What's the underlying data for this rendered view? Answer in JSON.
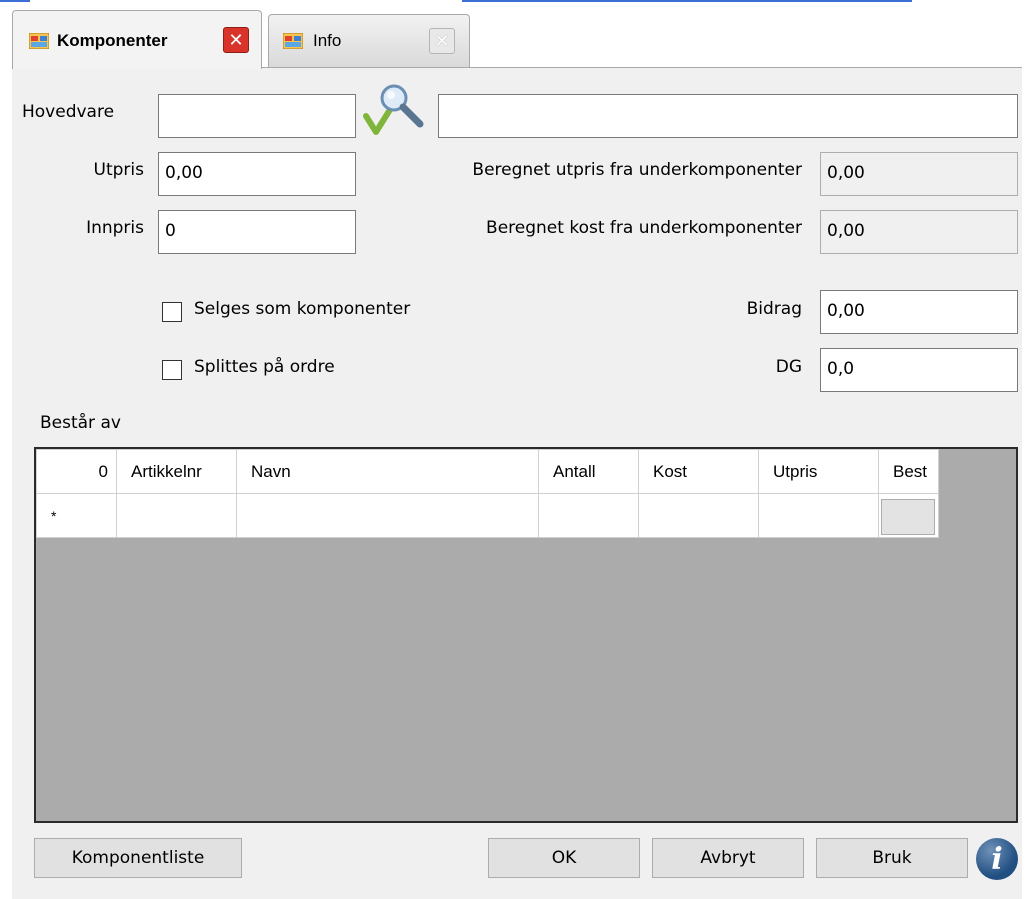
{
  "tabs": [
    {
      "label": "Komponenter",
      "active": true,
      "icon": "window-icon",
      "close_icon": "close-red-icon"
    },
    {
      "label": "Info",
      "active": false,
      "icon": "window-icon",
      "close_icon": "close-gray-icon"
    }
  ],
  "form": {
    "hovedvare": {
      "label": "Hovedvare",
      "code_value": "",
      "description_value": "",
      "search_icon": "search-magnifier-icon"
    },
    "utpris": {
      "label": "Utpris",
      "value": "0,00"
    },
    "innpris": {
      "label": "Innpris",
      "value": "0"
    },
    "beregnet_utpris": {
      "label": "Beregnet utpris fra underkomponenter",
      "value": "0,00"
    },
    "beregnet_kost": {
      "label": "Beregnet kost fra underkomponenter",
      "value": "0,00"
    },
    "bidrag": {
      "label": "Bidrag",
      "value": "0,00"
    },
    "dg": {
      "label": "DG",
      "value": "0,0"
    },
    "selges_som_komponenter": {
      "label": "Selges som komponenter",
      "checked": false
    },
    "splittes_paa_ordre": {
      "label": "Splittes på ordre",
      "checked": false
    }
  },
  "grid": {
    "section_label": "Består av",
    "row_count": "0",
    "columns": [
      "Artikkelnr",
      "Navn",
      "Antall",
      "Kost",
      "Utpris",
      "Best"
    ],
    "new_row_marker": "*"
  },
  "buttons": {
    "komponentliste": "Komponentliste",
    "ok": "OK",
    "avbryt": "Avbryt",
    "bruk": "Bruk",
    "info_icon_glyph": "i"
  },
  "colors": {
    "tab_close_active": "#d9342b",
    "panel_bg": "#f0f0f0",
    "grid_bg": "#ababab",
    "info_icon": "#2a5a8f"
  }
}
